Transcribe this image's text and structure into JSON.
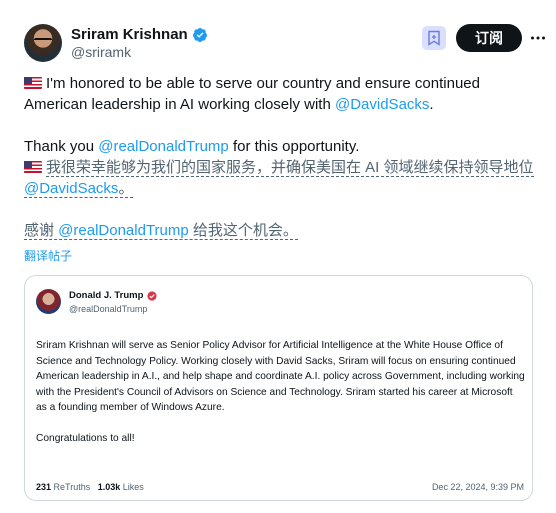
{
  "author": {
    "name": "Sriram Krishnan",
    "handle": "@sriramk"
  },
  "actions": {
    "subscribe_label": "订阅"
  },
  "tweet": {
    "line1_text": "I'm honored to be able to serve our country and ensure continued American leadership in AI working closely with ",
    "line1_mention": "@DavidSacks",
    "line1_end": ".",
    "thanks_pre": "Thank you ",
    "thanks_mention": "@realDonaldTrump",
    "thanks_post": " for this opportunity.",
    "zh1_text": "我很荣幸能够为我们的国家服务，并确保美国在 AI 领域继续保持领导地位 ",
    "zh1_mention": "@DavidSacks",
    "zh1_end": "。",
    "zh2_pre": "感谢 ",
    "zh2_mention": "@realDonaldTrump",
    "zh2_post": " 给我这个机会。"
  },
  "translate_label": "翻译帖子",
  "embedded_post": {
    "name": "Donald J. Trump",
    "handle": "@realDonaldTrump",
    "body": "Sriram Krishnan will serve as Senior Policy Advisor for Artificial Intelligence at the White House Office of Science and Technology Policy. Working closely with David Sacks, Sriram will focus on ensuring continued American leadership in A.I., and help shape and coordinate A.I. policy across Government, including working with the President's Council of Advisors on Science and Technology. Sriram started his career at Microsoft as a founding member of Windows Azure.",
    "closing": "Congratulations to all!",
    "retruths_count": "231",
    "retruths_label": "ReTruths",
    "likes_count": "1.03k",
    "likes_label": "Likes",
    "date": "Dec 22, 2024, 9:39 PM"
  },
  "colors": {
    "accent": "#1d9bf0",
    "text": "#0f1419",
    "muted": "#536471",
    "border": "#cfd9de"
  },
  "icons": {
    "verified": "verified-badge-icon",
    "bookmark": "bookmark-plus-icon",
    "more": "more-horizontal-icon",
    "flag": "us-flag-icon"
  }
}
